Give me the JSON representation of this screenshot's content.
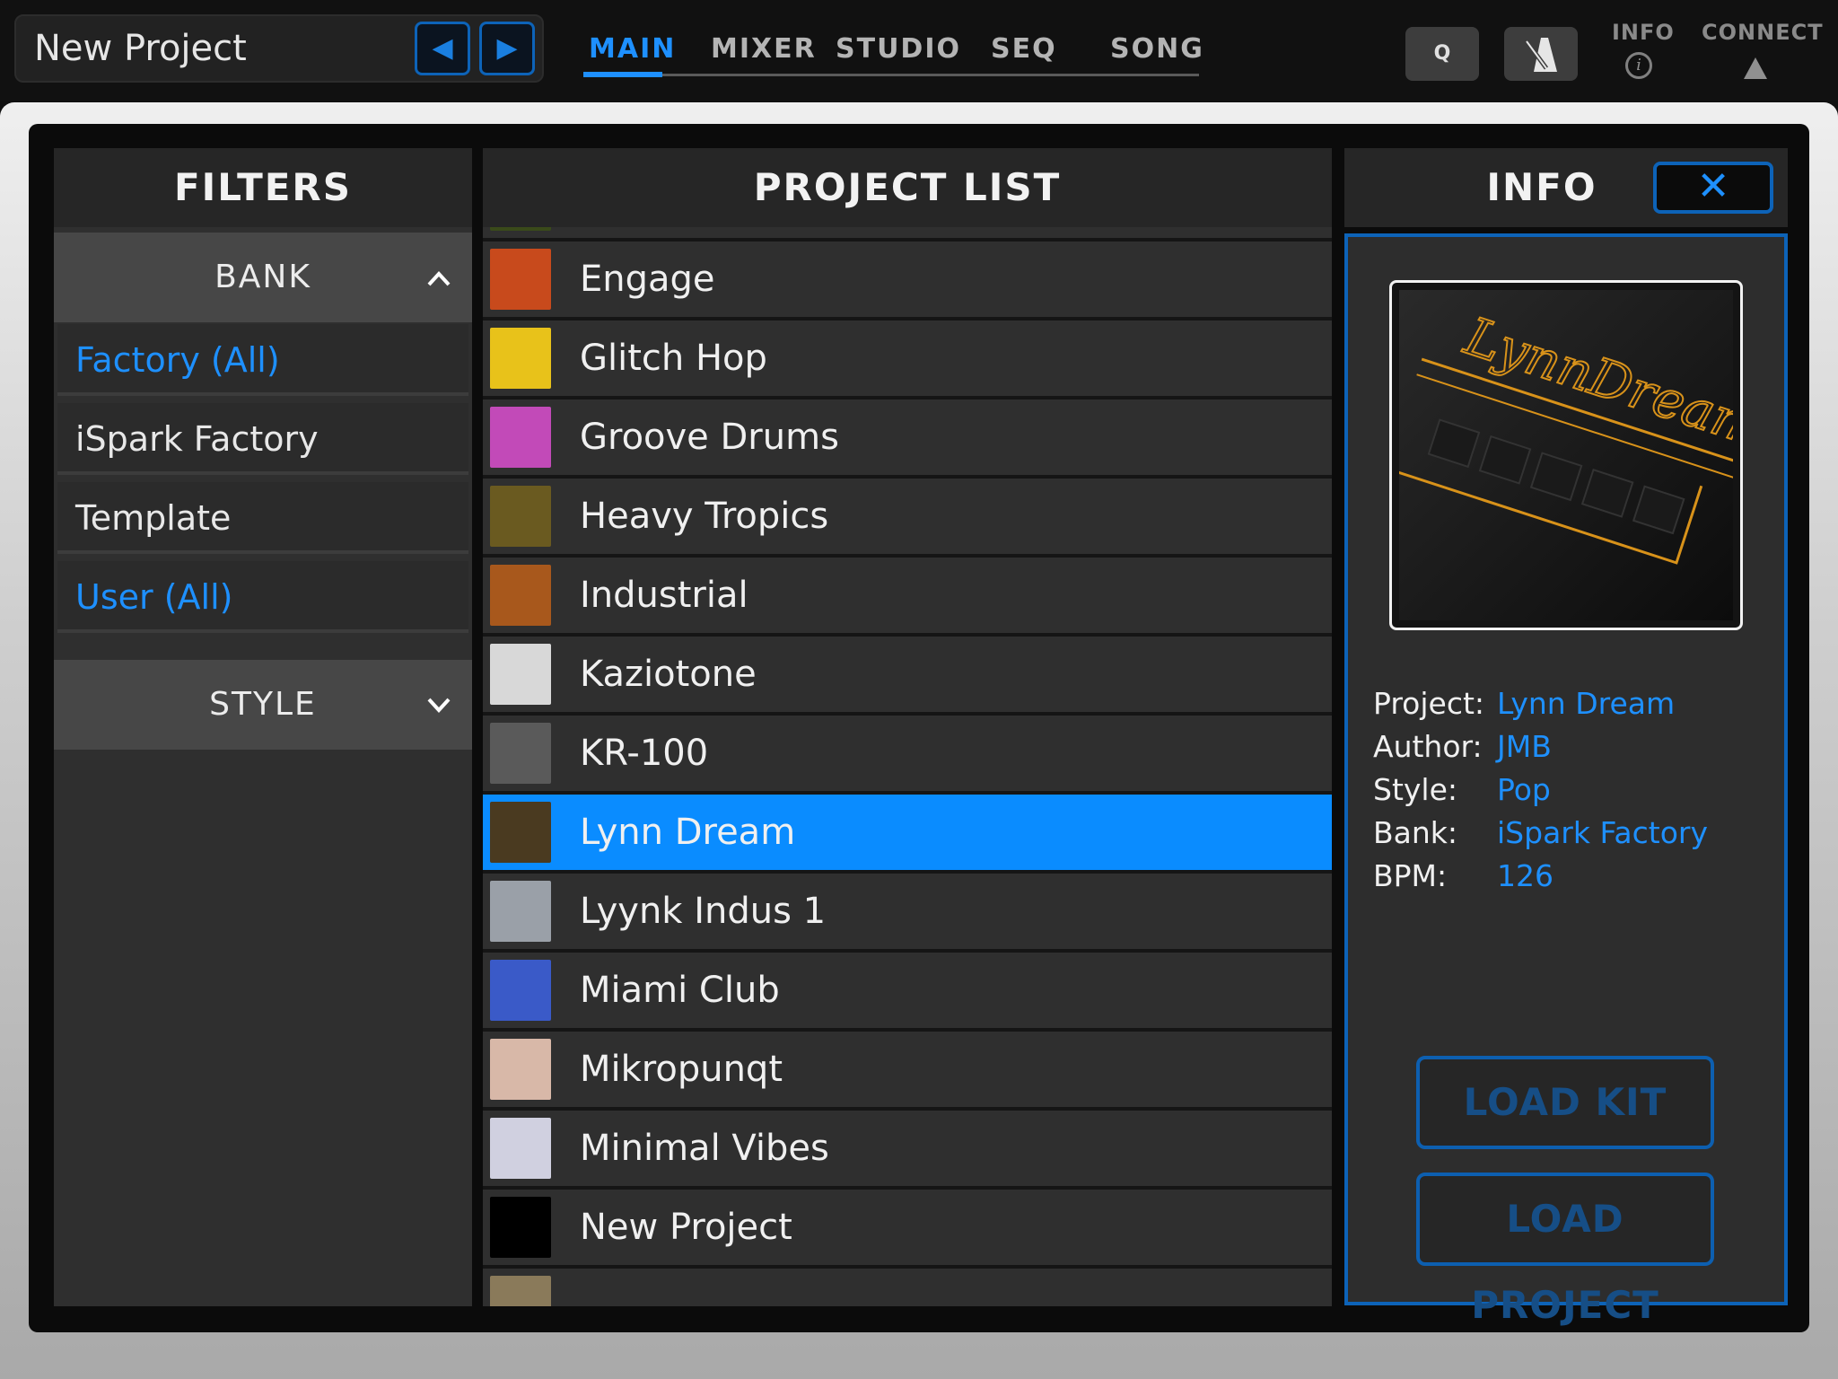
{
  "header": {
    "project_title": "New Project",
    "prev_icon": "◀",
    "next_icon": "▶",
    "tabs": [
      {
        "label": "MAIN",
        "active": true
      },
      {
        "label": "MIXER",
        "active": false
      },
      {
        "label": "STUDIO",
        "active": false
      },
      {
        "label": "SEQ",
        "active": false
      },
      {
        "label": "SONG",
        "active": false
      }
    ],
    "quantize_label": "Q",
    "metronome_icon": "metronome-icon",
    "info_label": "INFO",
    "info_icon": "i",
    "connect_label": "CONNECT"
  },
  "filters": {
    "title": "FILTERS",
    "bank": {
      "label": "BANK",
      "chevron": "^",
      "items": [
        {
          "label": "Factory (All)",
          "highlight": true
        },
        {
          "label": "iSpark Factory",
          "highlight": false
        },
        {
          "label": "Template",
          "highlight": false
        },
        {
          "label": "User (All)",
          "highlight": true
        }
      ]
    },
    "style": {
      "label": "STYLE",
      "chevron": "⌄"
    }
  },
  "project_list": {
    "title": "PROJECT LIST",
    "items": [
      {
        "label": "",
        "thumb": "#3a4a1a"
      },
      {
        "label": "Engage",
        "thumb": "#c84a1c"
      },
      {
        "label": "Glitch Hop",
        "thumb": "#e8c21a"
      },
      {
        "label": "Groove Drums",
        "thumb": "#c24ab8"
      },
      {
        "label": "Heavy Tropics",
        "thumb": "#6a5a20"
      },
      {
        "label": "Industrial",
        "thumb": "#a8581c"
      },
      {
        "label": "Kaziotone",
        "thumb": "#d8d8d8"
      },
      {
        "label": "KR-100",
        "thumb": "#5a5a5a"
      },
      {
        "label": "Lynn Dream",
        "thumb": "#4a3a20",
        "selected": true
      },
      {
        "label": "Lyynk Indus 1",
        "thumb": "#9aa0a8"
      },
      {
        "label": "Miami Club",
        "thumb": "#3a5ac8"
      },
      {
        "label": "Mikropunqt",
        "thumb": "#d8b8a8"
      },
      {
        "label": "Minimal Vibes",
        "thumb": "#d0d0e0"
      },
      {
        "label": "New Project",
        "thumb": "#000000"
      },
      {
        "label": "",
        "thumb": "#8a7a5a"
      }
    ]
  },
  "info": {
    "title": "INFO",
    "close_icon": "✕",
    "art_text": "LynnDream",
    "fields": [
      {
        "key": "Project:",
        "value": "Lynn Dream"
      },
      {
        "key": "Author:",
        "value": "JMB"
      },
      {
        "key": "Style:",
        "value": "Pop"
      },
      {
        "key": "Bank:",
        "value": "iSpark Factory"
      },
      {
        "key": "BPM:",
        "value": "126"
      }
    ],
    "load_kit_label": "LOAD KIT",
    "load_project_label": "LOAD PROJECT"
  },
  "colors": {
    "accent": "#1e90ff",
    "selected_row": "#0a8cff",
    "button_border": "#0d63b8"
  }
}
